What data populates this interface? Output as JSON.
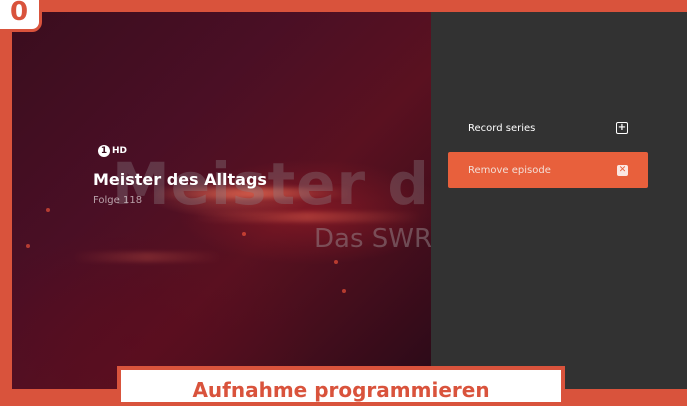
{
  "step": {
    "number": "0"
  },
  "video": {
    "background_title": "Meister des A",
    "background_subtitle": "Das SWR"
  },
  "program": {
    "channel_logo": {
      "icon": "channel-1-icon",
      "number": "1",
      "badge": "HD"
    },
    "title": "Meister des Alltags",
    "episode": "Folge 118"
  },
  "menu": {
    "items": [
      {
        "label": "Record series",
        "icon": "record-series-icon",
        "icon_glyph": "+",
        "selected": false
      },
      {
        "label": "Remove episode",
        "icon": "remove-episode-icon",
        "icon_glyph": "✕",
        "selected": true
      }
    ]
  },
  "caption": {
    "text": "Aufnahme programmieren"
  },
  "colors": {
    "accent": "#e8603c",
    "frame": "#d9533c",
    "panel": "#323232"
  }
}
